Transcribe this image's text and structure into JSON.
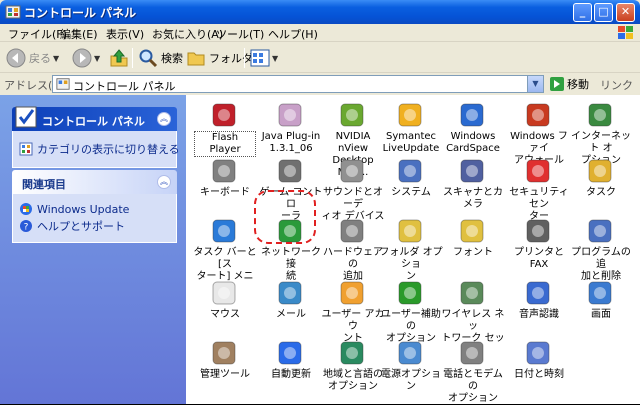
{
  "window": {
    "title": "コントロール パネル",
    "min": "_",
    "max": "□",
    "close": "✕"
  },
  "menu": [
    "ファイル(F)",
    "編集(E)",
    "表示(V)",
    "お気に入り(A)",
    "ツール(T)",
    "ヘルプ(H)"
  ],
  "toolbar": {
    "back": "戻る",
    "search": "検索",
    "folders": "フォルダ"
  },
  "address": {
    "label": "アドレス(D)",
    "value": "コントロール パネル",
    "go": "移動",
    "links": "リンク"
  },
  "taskpane": {
    "panel1": {
      "title": "コントロール パネル",
      "link": "カテゴリの表示に切り替える"
    },
    "panel2": {
      "title": "関連項目",
      "links": [
        "Windows Update",
        "ヘルプとサポート"
      ]
    }
  },
  "items": [
    "Flash Player",
    "Java Plug-in\n1.3.1_06",
    "NVIDIA nView\nDesktop Man...",
    "Symantec\nLiveUpdate",
    "Windows\nCardSpace",
    "Windows ファイ\nアウォール",
    "インターネット オ\nプション",
    "キーボード",
    "ゲーム コントロ\nーラ",
    "サウンドとオーデ\nィオ デバイス",
    "システム",
    "スキャナとカメラ",
    "セキュリティ セン\nター",
    "タスク",
    "タスク バーと [ス\nタート] メニュー",
    "ネットワーク接\n続",
    "ハードウェアの\n追加",
    "フォルダ オプショ\nン",
    "フォント",
    "プリンタと FAX",
    "プログラムの追\n加と削除",
    "マウス",
    "メール",
    "ユーザー アカウ\nント",
    "ユーザー補助の\nオプション",
    "ワイヤレス ネッ\nトワーク セット...",
    "音声認識",
    "画面",
    "管理ツール",
    "自動更新",
    "地域と言語の\nオプション",
    "電源オプション",
    "電話とモデムの\nオプション",
    "日付と時刻"
  ]
}
